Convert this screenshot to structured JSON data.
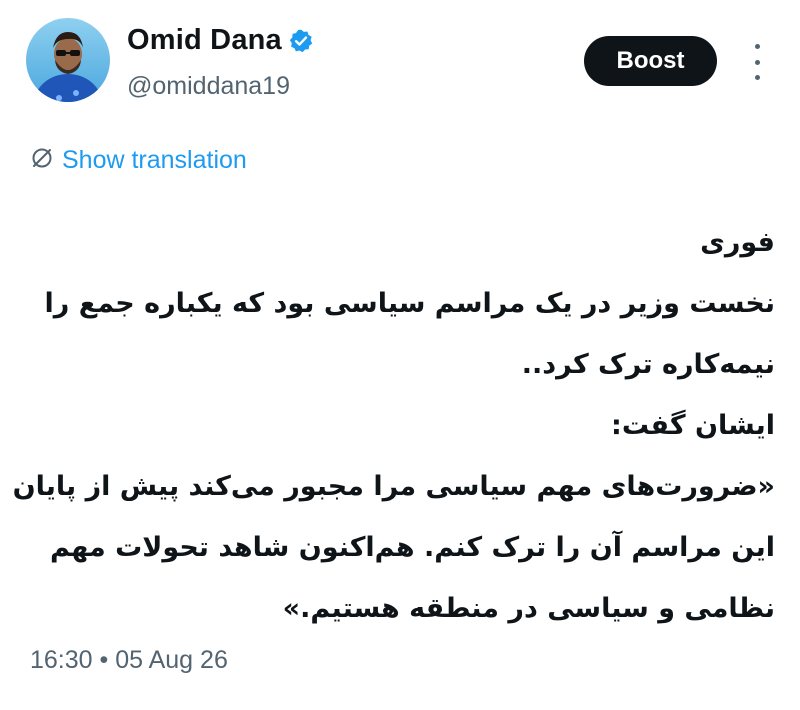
{
  "author": {
    "display_name": "Omid Dana",
    "handle": "@omiddana19",
    "verified": true
  },
  "actions": {
    "boost_label": "Boost"
  },
  "translation": {
    "label": "Show translation"
  },
  "tweet": {
    "lines": [
      "فوری",
      "نخست وزیر در یک مراسم سیاسی بود که یکباره جمع را",
      "نیمه‌کاره ترک کرد..",
      "ایشان گفت:",
      "«ضرورت‌های مهم سیاسی مرا مجبور می‌کند پیش از پایان",
      "این مراسم آن را ترک کنم. هم‌اکنون شاهد تحولات مهم",
      "نظامی و سیاسی در منطقه هستیم.»"
    ]
  },
  "meta": {
    "time": "16:30",
    "separator": "•",
    "date": "05 Aug 26"
  },
  "colors": {
    "accent": "#1d9bf0",
    "text": "#0f1419",
    "secondary": "#536471",
    "button": "#0f1419"
  }
}
